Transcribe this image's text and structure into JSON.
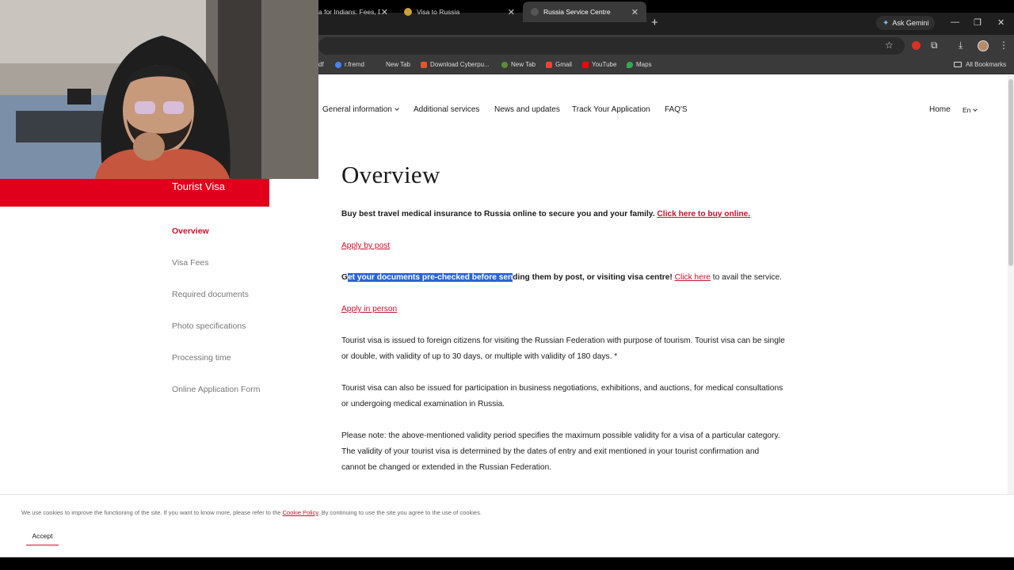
{
  "browser": {
    "tabs": [
      {
        "title": "a for Indians: Fees, Do",
        "active": false
      },
      {
        "title": "Visa to Russia",
        "active": false
      },
      {
        "title": "Russia Service Centre",
        "active": true
      }
    ],
    "ask_gemini": "Ask Gemini",
    "bookmarks": [
      "df",
      "r.fremd",
      "New Tab",
      "Download Cyberpu...",
      "New Tab",
      "Gmail",
      "YouTube",
      "Maps"
    ],
    "all_bookmarks": "All Bookmarks"
  },
  "nav": {
    "general_information": "General information",
    "additional_services": "Additional services",
    "news_and_updates": "News and updates",
    "track_your_application": "Track Your Application",
    "faqs": "FAQ'S",
    "home": "Home",
    "language": "En"
  },
  "sidebar": {
    "title": "Tourist Visa",
    "items": [
      "Overview",
      "Visa Fees",
      "Required documents",
      "Photo specifications",
      "Processing time",
      "Online Application Form"
    ]
  },
  "main": {
    "heading": "Overview",
    "insurance_text": "Buy best travel medical insurance to Russia online to secure you and your family.",
    "insurance_link": "Click here to buy online.",
    "apply_by_post": "Apply by post",
    "precheck_first": "G",
    "precheck_selected": "et your documents pre-checked before sen",
    "precheck_rest": "ding them by post, or visiting visa centre!",
    "precheck_link": "Click here",
    "precheck_after": "to avail the service.",
    "apply_in_person": "Apply in person",
    "para1": "Tourist visa is issued to foreign citizens for visiting the Russian Federation with purpose of tourism. Tourist visa can be single or double, with validity of up to 30 days, or multiple with validity of 180 days. *",
    "para2": "Tourist visa can also be issued for participation in business negotiations, exhibitions, and auctions, for medical consultations or undergoing medical examination in Russia.",
    "para3": "Please note: the above-mentioned validity period specifies the maximum possible validity for a visa of a particular category. The validity of your tourist visa is determined by the dates of entry and exit mentioned in your tourist confirmation and cannot be changed or extended in the Russian Federation."
  },
  "cookie": {
    "text_before": "We use cookies to improve the functioning of the site. If you want to know more, please refer to the",
    "policy_link": "Cookie Policy",
    "text_after": ". By continuing to use the site you agree to the use of cookies.",
    "accept": "Accept"
  },
  "colors": {
    "brand_red": "#e0001b",
    "link_red": "#c8102e",
    "selection_blue": "#2864d8"
  }
}
